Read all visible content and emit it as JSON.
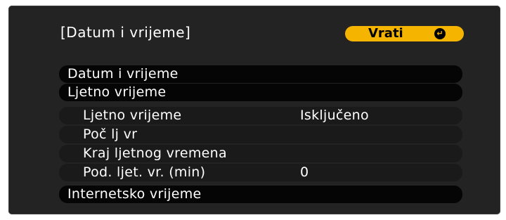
{
  "header": {
    "title": "[Datum i vrijeme]",
    "back_label": "Vrati",
    "back_icon": "enter-icon"
  },
  "menu": {
    "items": [
      {
        "label": "Datum i vrijeme",
        "value": ""
      },
      {
        "label": "Ljetno vrijeme",
        "value": ""
      },
      {
        "label": "Ljetno vrijeme",
        "value": "Isključeno"
      },
      {
        "label": "Poč lj vr",
        "value": ""
      },
      {
        "label": "Kraj ljetnog vremena",
        "value": ""
      },
      {
        "label": "Pod. ljet. vr. (min)",
        "value": "0"
      },
      {
        "label": "Internetsko vrijeme",
        "value": ""
      }
    ]
  },
  "colors": {
    "accent": "#f4b400",
    "panel": "#232323",
    "row_dark": "#050505",
    "row_sub": "#1a1a1a"
  }
}
